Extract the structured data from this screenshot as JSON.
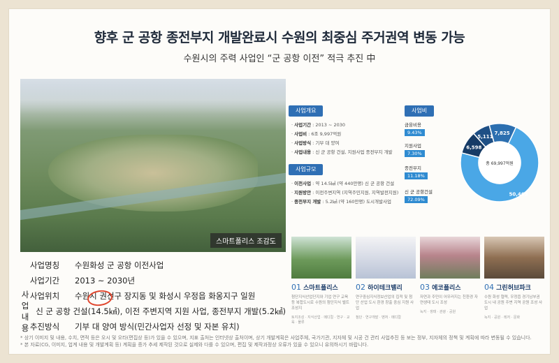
{
  "headline": "향후 군 공항 종전부지 개발완료시 수원의 최중심 주거권역 변동 가능",
  "subheadline": "수원시의 주력 사업인 “군 공항 이전” 적극 추진 中",
  "photo_caption": "스마트폴리스 조감도",
  "info": [
    {
      "key": "사업명칭",
      "value": "수원화성 군 공항 이전사업"
    },
    {
      "key": "사업기간",
      "value": "2013 ~ 2030년"
    },
    {
      "key": "사업위치",
      "value": "수원시 권선구 장지동 및 화성시 우정읍 화옹지구 일원"
    },
    {
      "key": "사업내용",
      "value": "신 군 공항 건설(14.5㎢), 이전 주변지역 지원 사업, 종전부지 개발(5.2㎢)"
    },
    {
      "key": "추진방식",
      "value": "기부 대 양여 방식(민간사업자 선정 및 자본 유치)"
    }
  ],
  "footnotes": [
    "* 상기 이미지 및 내용, 수치, 면적 등은 오시 및 오타(편집상 등)가 있을 수 있으며, 지표 출처는 인터넷상 출처이며, 상기 개발계획은 사업주체, 국가기관, 지자체 및 시공 건 관리 사업추진 등 보는 정부, 지자체의 정책 및 계획에 따라 변동될 수 있습니다.",
    "* 본 자료(CG, 이미지, 업계 내용 및 개발계획 등) 계획을 증가 추세 제작된 것으로 실제와 다를 수 있으며, 편집 및 제작과정상 오류가 있을 수 있으니 유의하시기 바랍니다."
  ],
  "overview": {
    "tag": "사업개요",
    "items": [
      {
        "label": "사업기간",
        "value": "2013 ~ 2030"
      },
      {
        "label": "사업비",
        "value": "6조 9,997억원"
      },
      {
        "label": "사업방식",
        "value": "기부 대 양여"
      },
      {
        "label": "사업내용",
        "value": "신 군 공항 건설, 지원사업 종전부지 개발"
      }
    ]
  },
  "scale": {
    "tag": "사업규모",
    "items": [
      {
        "label": "이전사업",
        "value": "약 14.5㎢ (약 440만평) 신 군 공항 건설"
      },
      {
        "label": "지원방안",
        "value": "이전주변지역 (지역주민지원, 지역발전지원)"
      },
      {
        "label": "종전부지 개발",
        "value": "5.2㎢ (약 160만평) 도시개발사업"
      }
    ]
  },
  "budget": {
    "tag": "사업비",
    "total": "총 69,997억원",
    "segments": [
      {
        "name": "신 군 공항건설",
        "value": 50463,
        "value_label": "50,463",
        "pct": "72.09%",
        "color": "#4aa7e6"
      },
      {
        "name": "종전부지",
        "value": 7825,
        "value_label": "7,825",
        "pct": "11.18%",
        "color": "#2c6fb0"
      },
      {
        "name": "지원사업",
        "value": 5111,
        "value_label": "5,111",
        "pct": "7.30%",
        "color": "#1e4f85"
      },
      {
        "name": "금융비용",
        "value": 6598,
        "value_label": "6,598",
        "pct": "9.43%",
        "color": "#163b66"
      }
    ]
  },
  "projects": [
    {
      "num": "01",
      "title": "스마트폴리스",
      "desc": "첨단지식산업단지와 기업 연구 교육등 복합도시로 수원의 첨단지식 벨트 조성지",
      "sub": "토지조성 · 지식산업 · 메디컬 · 연구 · 교육 · 물류"
    },
    {
      "num": "02",
      "title": "하이테크밸리",
      "desc": "연구중심지식정보산업의 집적 및 첨단 산업 도시 환경 창출 중심 지원 사업",
      "sub": "첨단 · 연구개발 · 벤처 · 메디컬"
    },
    {
      "num": "03",
      "title": "에코폴리스",
      "desc": "자연과 주민이 어우러지는 친환경 자연생태 도시 조성",
      "sub": "녹지 · 생태 · 관광 · 공원"
    },
    {
      "num": "04",
      "title": "그린허브파크",
      "desc": "수원 화성 협력, 우정읍 경기남부권 도시 내 공원 주변 지역 공원 조성 사업",
      "sub": "녹지 · 공원 · 레저 · 문화"
    }
  ]
}
